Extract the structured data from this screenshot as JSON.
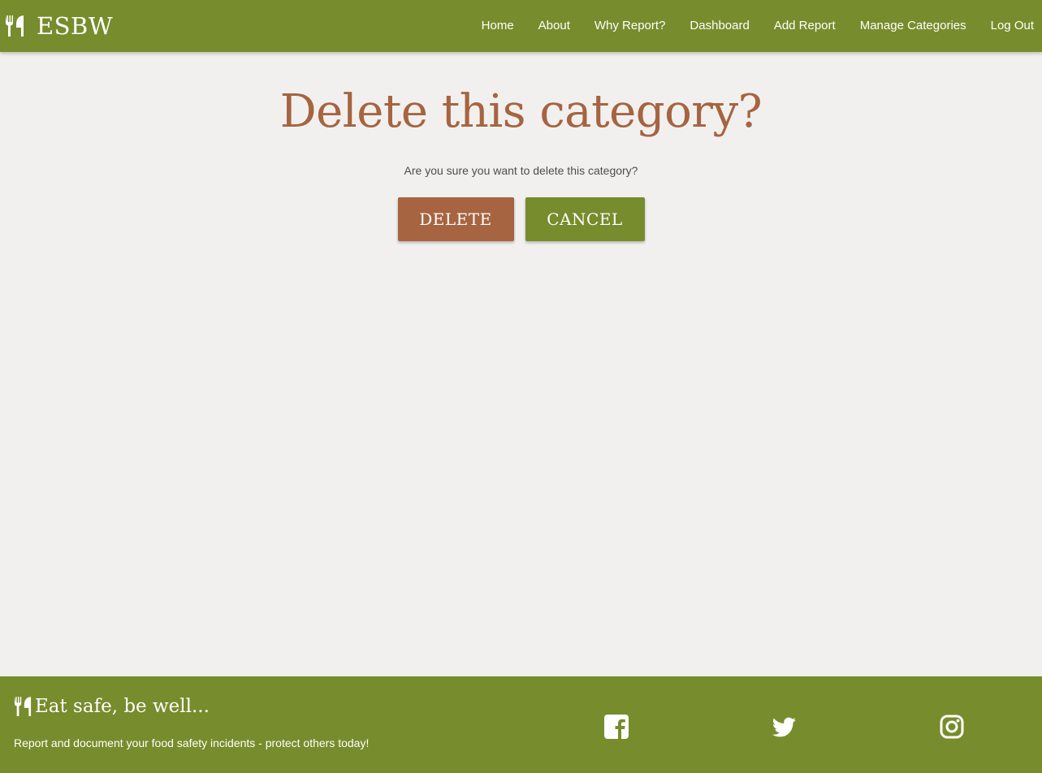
{
  "navbar": {
    "brand": "ESBW",
    "brand_icon": "utensils-icon",
    "links": [
      "Home",
      "About",
      "Why Report?",
      "Dashboard",
      "Add Report",
      "Manage Categories",
      "Log Out"
    ]
  },
  "main": {
    "title": "Delete this category?",
    "message": "Are you sure you want to delete this category?",
    "delete_label": "DELETE",
    "cancel_label": "CANCEL"
  },
  "footer": {
    "tagline": "Eat safe, be well...",
    "tagline_icon": "utensils-icon",
    "description": "Report and document your food safety incidents - protect others today!",
    "social": [
      "facebook-icon",
      "twitter-icon",
      "instagram-icon"
    ]
  },
  "colors": {
    "primary_green": "#778c2c",
    "accent_brown": "#a66440",
    "background": "#f2f0ee",
    "text_muted": "#4d4d4d",
    "white": "#ffffff"
  }
}
